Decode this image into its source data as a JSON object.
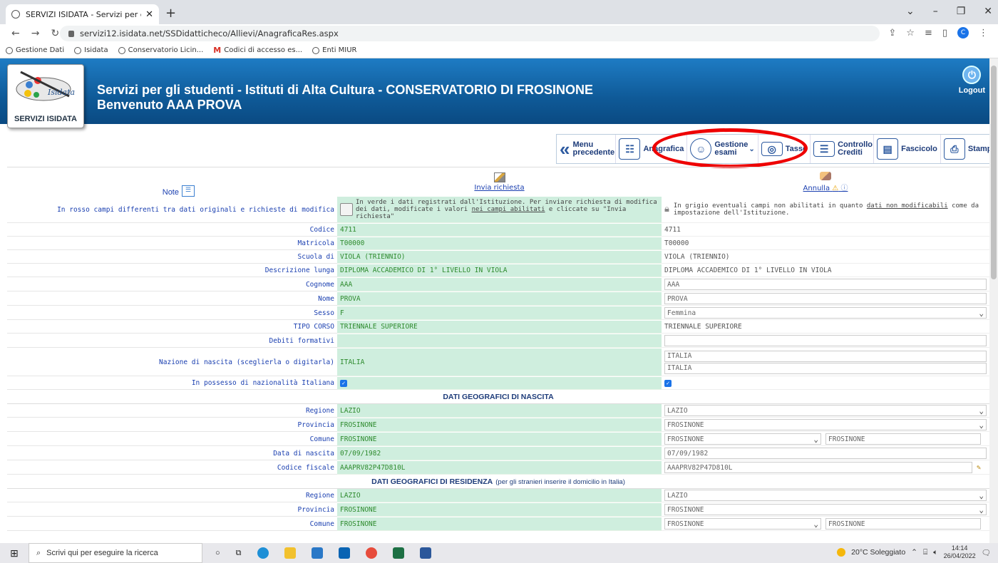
{
  "browser": {
    "tab_title": "SERVIZI ISIDATA - Servizi per gli st",
    "url": "servizi12.isidata.net/SSDidatticheco/Allievi/AnagraficaRes.aspx",
    "bookmarks": [
      "Gestione Dati",
      "Isidata",
      "Conservatorio Licin...",
      "Codici di accesso es...",
      "Enti MIUR"
    ],
    "profile_initial": "C"
  },
  "header": {
    "logo_caption": "SERVIZI ISIDATA",
    "title": "Servizi per gli studenti - Istituti di Alta Cultura - CONSERVATORIO DI FROSINONE",
    "welcome": "Benvenuto AAA PROVA",
    "logout": "Logout"
  },
  "toolbar": {
    "menu": "Menu precedente",
    "anagrafica": "Anagrafica",
    "gestione": "Gestione esami",
    "tasse": "Tasse",
    "controllo": "Controllo Crediti",
    "fascicolo": "Fascicolo",
    "stampe": "Stampe"
  },
  "actions": {
    "note": "Note",
    "send": "Invia richiesta",
    "cancel": "Annulla"
  },
  "legend": {
    "left": "In rosso campi differenti tra dati originali e richieste di modifica",
    "mid_1": "In verde i dati registrati dall'Istituzione. Per inviare richiesta di modifica dei dati, modificate i valori ",
    "mid_link": "nei campi abilitati",
    "mid_2": " e cliccate su \"Invia richiesta\"",
    "right_1": "In grigio eventuali campi non abilitati in quanto ",
    "right_link": "dati non modificabili",
    "right_2": " come da impostazione dell'Istituzione."
  },
  "rows": {
    "codice": {
      "label": "Codice",
      "orig": "4711",
      "val": "4711"
    },
    "matricola": {
      "label": "Matricola",
      "orig": "T00000",
      "val": "T00000"
    },
    "scuola": {
      "label": "Scuola di",
      "orig": "VIOLA (TRIENNIO)",
      "val": "VIOLA (TRIENNIO)"
    },
    "descr": {
      "label": "Descrizione lunga",
      "orig": "DIPLOMA ACCADEMICO DI 1° LIVELLO IN VIOLA",
      "val": "DIPLOMA ACCADEMICO DI 1° LIVELLO IN VIOLA"
    },
    "cognome": {
      "label": "Cognome",
      "orig": "AAA",
      "val": "AAA"
    },
    "nome": {
      "label": "Nome",
      "orig": "PROVA",
      "val": "PROVA"
    },
    "sesso": {
      "label": "Sesso",
      "orig": "F",
      "val": "Femmina"
    },
    "tipo": {
      "label": "TIPO CORSO",
      "orig": "TRIENNALE SUPERIORE",
      "val": "TRIENNALE SUPERIORE"
    },
    "debiti": {
      "label": "Debiti formativi",
      "orig": "",
      "val": ""
    },
    "nazione": {
      "label": "Nazione di nascita (sceglierla o digitarla)",
      "orig": "ITALIA",
      "val": "ITALIA",
      "val2": "ITALIA"
    },
    "nazionalita": {
      "label": "In possesso di nazionalità Italiana"
    }
  },
  "sect_nascita": "DATI GEOGRAFICI DI NASCITA",
  "nascita": {
    "regione": {
      "label": "Regione",
      "orig": "LAZIO",
      "val": "LAZIO"
    },
    "provincia": {
      "label": "Provincia",
      "orig": "FROSINONE",
      "val": "FROSINONE"
    },
    "comune": {
      "label": "Comune",
      "orig": "FROSINONE",
      "val": "FROSINONE",
      "val2": "FROSINONE"
    },
    "data": {
      "label": "Data di nascita",
      "orig": "07/09/1982",
      "val": "07/09/1982"
    },
    "cf": {
      "label": "Codice fiscale",
      "orig": "AAAPRV82P47D810L",
      "val": "AAAPRV82P47D810L"
    }
  },
  "sect_residenza": "DATI GEOGRAFICI DI RESIDENZA",
  "sect_residenza_sub": "(per gli stranieri inserire il domicilio in Italia)",
  "residenza": {
    "regione": {
      "label": "Regione",
      "orig": "LAZIO",
      "val": "LAZIO"
    },
    "provincia": {
      "label": "Provincia",
      "orig": "FROSINONE",
      "val": "FROSINONE"
    },
    "comune": {
      "label": "Comune",
      "orig": "FROSINONE",
      "val": "FROSINONE",
      "val2": "FROSINONE"
    }
  },
  "taskbar": {
    "search": "Scrivi qui per eseguire la ricerca",
    "weather": "20°C Soleggiato",
    "time": "14:14",
    "date": "26/04/2022"
  }
}
